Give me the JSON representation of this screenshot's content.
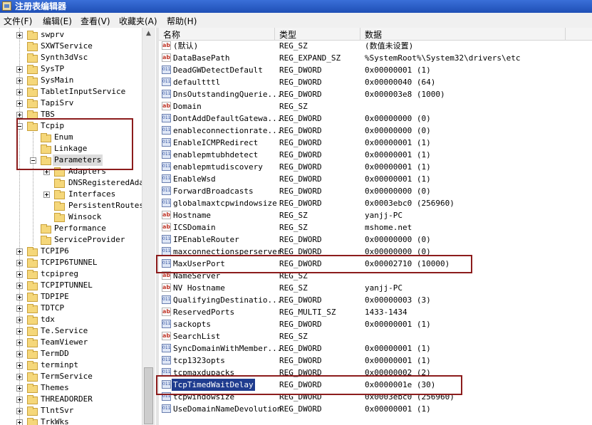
{
  "window": {
    "title": "注册表编辑器"
  },
  "menu": [
    {
      "label": "文件(F)"
    },
    {
      "label": "编辑(E)"
    },
    {
      "label": "查看(V)"
    },
    {
      "label": "收藏夹(A)"
    },
    {
      "label": "帮助(H)"
    }
  ],
  "tree": {
    "items": [
      {
        "label": "swprv",
        "level": 0,
        "expander": "plus"
      },
      {
        "label": "SXWTService",
        "level": 0,
        "expander": "none"
      },
      {
        "label": "Synth3dVsc",
        "level": 0,
        "expander": "none"
      },
      {
        "label": "SysTP",
        "level": 0,
        "expander": "plus"
      },
      {
        "label": "SysMain",
        "level": 0,
        "expander": "plus"
      },
      {
        "label": "TabletInputService",
        "level": 0,
        "expander": "plus"
      },
      {
        "label": "TapiSrv",
        "level": 0,
        "expander": "plus"
      },
      {
        "label": "TBS",
        "level": 0,
        "expander": "plus"
      },
      {
        "label": "Tcpip",
        "level": 0,
        "expander": "minus"
      },
      {
        "label": "Enum",
        "level": 1,
        "expander": "none"
      },
      {
        "label": "Linkage",
        "level": 1,
        "expander": "none"
      },
      {
        "label": "Parameters",
        "level": 1,
        "expander": "minus",
        "selected": true
      },
      {
        "label": "Adapters",
        "level": 2,
        "expander": "plus"
      },
      {
        "label": "DNSRegisteredAdap",
        "level": 2,
        "expander": "none"
      },
      {
        "label": "Interfaces",
        "level": 2,
        "expander": "plus"
      },
      {
        "label": "PersistentRoutes",
        "level": 2,
        "expander": "none"
      },
      {
        "label": "Winsock",
        "level": 2,
        "expander": "none"
      },
      {
        "label": "Performance",
        "level": 1,
        "expander": "none"
      },
      {
        "label": "ServiceProvider",
        "level": 1,
        "expander": "none"
      },
      {
        "label": "TCPIP6",
        "level": 0,
        "expander": "plus"
      },
      {
        "label": "TCPIP6TUNNEL",
        "level": 0,
        "expander": "plus"
      },
      {
        "label": "tcpipreg",
        "level": 0,
        "expander": "plus"
      },
      {
        "label": "TCPIPTUNNEL",
        "level": 0,
        "expander": "plus"
      },
      {
        "label": "TDPIPE",
        "level": 0,
        "expander": "plus"
      },
      {
        "label": "TDTCP",
        "level": 0,
        "expander": "plus"
      },
      {
        "label": "tdx",
        "level": 0,
        "expander": "plus"
      },
      {
        "label": "Te.Service",
        "level": 0,
        "expander": "plus"
      },
      {
        "label": "TeamViewer",
        "level": 0,
        "expander": "plus"
      },
      {
        "label": "TermDD",
        "level": 0,
        "expander": "plus"
      },
      {
        "label": "terminpt",
        "level": 0,
        "expander": "plus"
      },
      {
        "label": "TermService",
        "level": 0,
        "expander": "plus"
      },
      {
        "label": "Themes",
        "level": 0,
        "expander": "plus"
      },
      {
        "label": "THREADORDER",
        "level": 0,
        "expander": "plus"
      },
      {
        "label": "TlntSvr",
        "level": 0,
        "expander": "plus"
      },
      {
        "label": "TrkWks",
        "level": 0,
        "expander": "plus"
      }
    ]
  },
  "list": {
    "columns": [
      "名称",
      "类型",
      "数据"
    ],
    "rows": [
      {
        "icon": "string-value-icon",
        "name": "(默认)",
        "type": "REG_SZ",
        "data": "(数值未设置)"
      },
      {
        "icon": "string-value-icon",
        "name": "DataBasePath",
        "type": "REG_EXPAND_SZ",
        "data": "%SystemRoot%\\System32\\drivers\\etc"
      },
      {
        "icon": "binary-value-icon",
        "name": "DeadGWDetectDefault",
        "type": "REG_DWORD",
        "data": "0x00000001 (1)"
      },
      {
        "icon": "binary-value-icon",
        "name": "defaultttl",
        "type": "REG_DWORD",
        "data": "0x00000040 (64)"
      },
      {
        "icon": "binary-value-icon",
        "name": "DnsOutstandingQuerie...",
        "type": "REG_DWORD",
        "data": "0x000003e8 (1000)"
      },
      {
        "icon": "string-value-icon",
        "name": "Domain",
        "type": "REG_SZ",
        "data": ""
      },
      {
        "icon": "binary-value-icon",
        "name": "DontAddDefaultGatewa...",
        "type": "REG_DWORD",
        "data": "0x00000000 (0)"
      },
      {
        "icon": "binary-value-icon",
        "name": "enableconnectionrate...",
        "type": "REG_DWORD",
        "data": "0x00000000 (0)"
      },
      {
        "icon": "binary-value-icon",
        "name": "EnableICMPRedirect",
        "type": "REG_DWORD",
        "data": "0x00000001 (1)"
      },
      {
        "icon": "binary-value-icon",
        "name": "enablepmtubhdetect",
        "type": "REG_DWORD",
        "data": "0x00000001 (1)"
      },
      {
        "icon": "binary-value-icon",
        "name": "enablepmtudiscovery",
        "type": "REG_DWORD",
        "data": "0x00000001 (1)"
      },
      {
        "icon": "binary-value-icon",
        "name": "EnableWsd",
        "type": "REG_DWORD",
        "data": "0x00000001 (1)"
      },
      {
        "icon": "binary-value-icon",
        "name": "ForwardBroadcasts",
        "type": "REG_DWORD",
        "data": "0x00000000 (0)"
      },
      {
        "icon": "binary-value-icon",
        "name": "globalmaxtcpwindowsize",
        "type": "REG_DWORD",
        "data": "0x0003ebc0 (256960)"
      },
      {
        "icon": "string-value-icon",
        "name": "Hostname",
        "type": "REG_SZ",
        "data": "yanjj-PC"
      },
      {
        "icon": "string-value-icon",
        "name": "ICSDomain",
        "type": "REG_SZ",
        "data": "mshome.net"
      },
      {
        "icon": "binary-value-icon",
        "name": "IPEnableRouter",
        "type": "REG_DWORD",
        "data": "0x00000000 (0)"
      },
      {
        "icon": "binary-value-icon",
        "name": "maxconnectionsperserver",
        "type": "REG_DWORD",
        "data": "0x00000000 (0)"
      },
      {
        "icon": "binary-value-icon",
        "name": "MaxUserPort",
        "type": "REG_DWORD",
        "data": "0x00002710 (10000)"
      },
      {
        "icon": "string-value-icon",
        "name": "NameServer",
        "type": "REG_SZ",
        "data": ""
      },
      {
        "icon": "string-value-icon",
        "name": "NV Hostname",
        "type": "REG_SZ",
        "data": "yanjj-PC"
      },
      {
        "icon": "binary-value-icon",
        "name": "QualifyingDestinatio...",
        "type": "REG_DWORD",
        "data": "0x00000003 (3)"
      },
      {
        "icon": "string-value-icon",
        "name": "ReservedPorts",
        "type": "REG_MULTI_SZ",
        "data": "1433-1434"
      },
      {
        "icon": "binary-value-icon",
        "name": "sackopts",
        "type": "REG_DWORD",
        "data": "0x00000001 (1)"
      },
      {
        "icon": "string-value-icon",
        "name": "SearchList",
        "type": "REG_SZ",
        "data": ""
      },
      {
        "icon": "binary-value-icon",
        "name": "SyncDomainWithMember...",
        "type": "REG_DWORD",
        "data": "0x00000001 (1)"
      },
      {
        "icon": "binary-value-icon",
        "name": "tcp1323opts",
        "type": "REG_DWORD",
        "data": "0x00000001 (1)"
      },
      {
        "icon": "binary-value-icon",
        "name": "tcpmaxdupacks",
        "type": "REG_DWORD",
        "data": "0x00000002 (2)"
      },
      {
        "icon": "binary-value-icon",
        "name": "TcpTimedWaitDelay",
        "type": "REG_DWORD",
        "data": "0x0000001e (30)",
        "selected": true
      },
      {
        "icon": "binary-value-icon",
        "name": "tcpwindowsize",
        "type": "REG_DWORD",
        "data": "0x0003ebc0 (256960)"
      },
      {
        "icon": "binary-value-icon",
        "name": "UseDomainNameDevolution",
        "type": "REG_DWORD",
        "data": "0x00000001 (1)"
      }
    ]
  },
  "scrollbar": {
    "up_arrow": "▲"
  },
  "colors": {
    "selection": "#1f3c8f",
    "annotation_box": "#8c1c1c",
    "title_bar": "#2456c4"
  }
}
